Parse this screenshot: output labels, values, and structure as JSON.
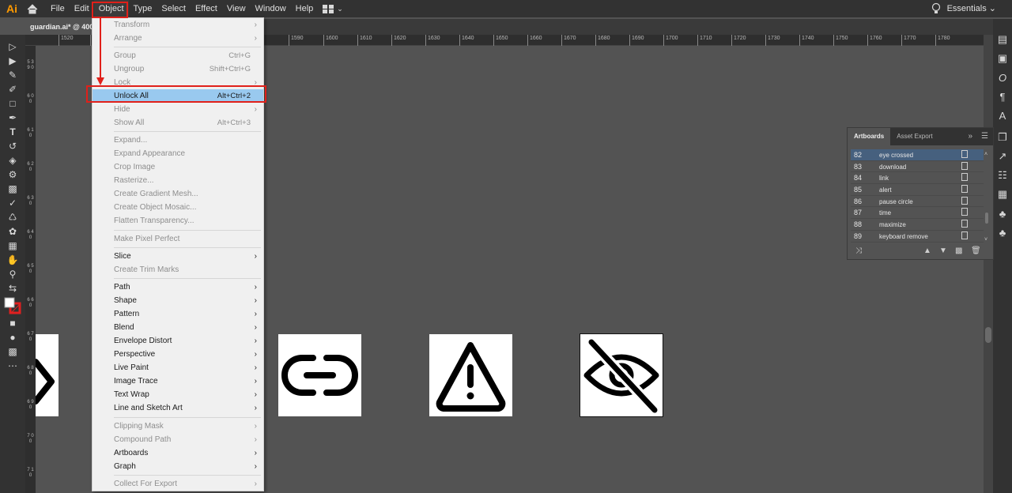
{
  "app": {
    "logo": "Ai",
    "workspace": "Essentials"
  },
  "menubar": [
    "File",
    "Edit",
    "Object",
    "Type",
    "Select",
    "Effect",
    "View",
    "Window",
    "Help"
  ],
  "document": {
    "tab_title": "guardian.ai* @ 400"
  },
  "ruler": {
    "h_ticks": [
      "1520",
      "1580",
      "1590",
      "1600",
      "1610",
      "1620",
      "1630",
      "1640",
      "1650",
      "1660",
      "1670",
      "1680",
      "1690",
      "1700",
      "1710",
      "1720",
      "1730",
      "1740",
      "1750",
      "1760",
      "1770",
      "1780"
    ],
    "v_ticks": [
      "5 3 9 0",
      "6 0 0",
      "6 1 0",
      "6 2 0",
      "6 3 0",
      "6 4 0",
      "6 5 0",
      "6 6 0",
      "6 7 0",
      "6 8 0",
      "6 9 0",
      "7 0 0",
      "7 1 0"
    ]
  },
  "object_menu": {
    "items": [
      {
        "label": "Transform",
        "shortcut": "",
        "submenu": true,
        "disabled": true
      },
      {
        "label": "Arrange",
        "shortcut": "",
        "submenu": true,
        "disabled": true
      },
      {
        "label": "Group",
        "shortcut": "Ctrl+G",
        "submenu": false,
        "disabled": true
      },
      {
        "label": "Ungroup",
        "shortcut": "Shift+Ctrl+G",
        "submenu": false,
        "disabled": true
      },
      {
        "label": "Lock",
        "shortcut": "",
        "submenu": true,
        "disabled": true
      },
      {
        "label": "Unlock All",
        "shortcut": "Alt+Ctrl+2",
        "submenu": false,
        "disabled": false,
        "highlighted": true
      },
      {
        "label": "Hide",
        "shortcut": "",
        "submenu": true,
        "disabled": true
      },
      {
        "label": "Show All",
        "shortcut": "Alt+Ctrl+3",
        "submenu": false,
        "disabled": true
      },
      {
        "label": "Expand...",
        "shortcut": "",
        "submenu": false,
        "disabled": true
      },
      {
        "label": "Expand Appearance",
        "shortcut": "",
        "submenu": false,
        "disabled": true
      },
      {
        "label": "Crop Image",
        "shortcut": "",
        "submenu": false,
        "disabled": true
      },
      {
        "label": "Rasterize...",
        "shortcut": "",
        "submenu": false,
        "disabled": true
      },
      {
        "label": "Create Gradient Mesh...",
        "shortcut": "",
        "submenu": false,
        "disabled": true
      },
      {
        "label": "Create Object Mosaic...",
        "shortcut": "",
        "submenu": false,
        "disabled": true
      },
      {
        "label": "Flatten Transparency...",
        "shortcut": "",
        "submenu": false,
        "disabled": true
      },
      {
        "label": "Make Pixel Perfect",
        "shortcut": "",
        "submenu": false,
        "disabled": true
      },
      {
        "label": "Slice",
        "shortcut": "",
        "submenu": true,
        "disabled": false
      },
      {
        "label": "Create Trim Marks",
        "shortcut": "",
        "submenu": false,
        "disabled": true
      },
      {
        "label": "Path",
        "shortcut": "",
        "submenu": true,
        "disabled": false
      },
      {
        "label": "Shape",
        "shortcut": "",
        "submenu": true,
        "disabled": false
      },
      {
        "label": "Pattern",
        "shortcut": "",
        "submenu": true,
        "disabled": false
      },
      {
        "label": "Blend",
        "shortcut": "",
        "submenu": true,
        "disabled": false
      },
      {
        "label": "Envelope Distort",
        "shortcut": "",
        "submenu": true,
        "disabled": false
      },
      {
        "label": "Perspective",
        "shortcut": "",
        "submenu": true,
        "disabled": false
      },
      {
        "label": "Live Paint",
        "shortcut": "",
        "submenu": true,
        "disabled": false
      },
      {
        "label": "Image Trace",
        "shortcut": "",
        "submenu": true,
        "disabled": false
      },
      {
        "label": "Text Wrap",
        "shortcut": "",
        "submenu": true,
        "disabled": false
      },
      {
        "label": "Line and Sketch Art",
        "shortcut": "",
        "submenu": true,
        "disabled": false
      },
      {
        "label": "Clipping Mask",
        "shortcut": "",
        "submenu": true,
        "disabled": true
      },
      {
        "label": "Compound Path",
        "shortcut": "",
        "submenu": true,
        "disabled": true
      },
      {
        "label": "Artboards",
        "shortcut": "",
        "submenu": true,
        "disabled": false
      },
      {
        "label": "Graph",
        "shortcut": "",
        "submenu": true,
        "disabled": false
      },
      {
        "label": "Collect For Export",
        "shortcut": "",
        "submenu": true,
        "disabled": true
      }
    ]
  },
  "artboards_panel": {
    "tabs": [
      "Artboards",
      "Asset Export"
    ],
    "rows": [
      {
        "num": "82",
        "name": "eye crossed",
        "selected": true
      },
      {
        "num": "83",
        "name": "download",
        "selected": false
      },
      {
        "num": "84",
        "name": "link",
        "selected": false
      },
      {
        "num": "85",
        "name": "alert",
        "selected": false
      },
      {
        "num": "86",
        "name": "pause circle",
        "selected": false
      },
      {
        "num": "87",
        "name": "time",
        "selected": false
      },
      {
        "num": "88",
        "name": "maximize",
        "selected": false
      },
      {
        "num": "89",
        "name": "keyboard remove",
        "selected": false
      }
    ]
  },
  "canvas_icons": [
    "chevron-partial-icon",
    "link-icon",
    "alert-icon",
    "eye-crossed-icon"
  ],
  "colors": {
    "annotation_red": "#e0201a",
    "menu_highlight": "#99c9ef",
    "logo_orange": "#ff9a00"
  }
}
